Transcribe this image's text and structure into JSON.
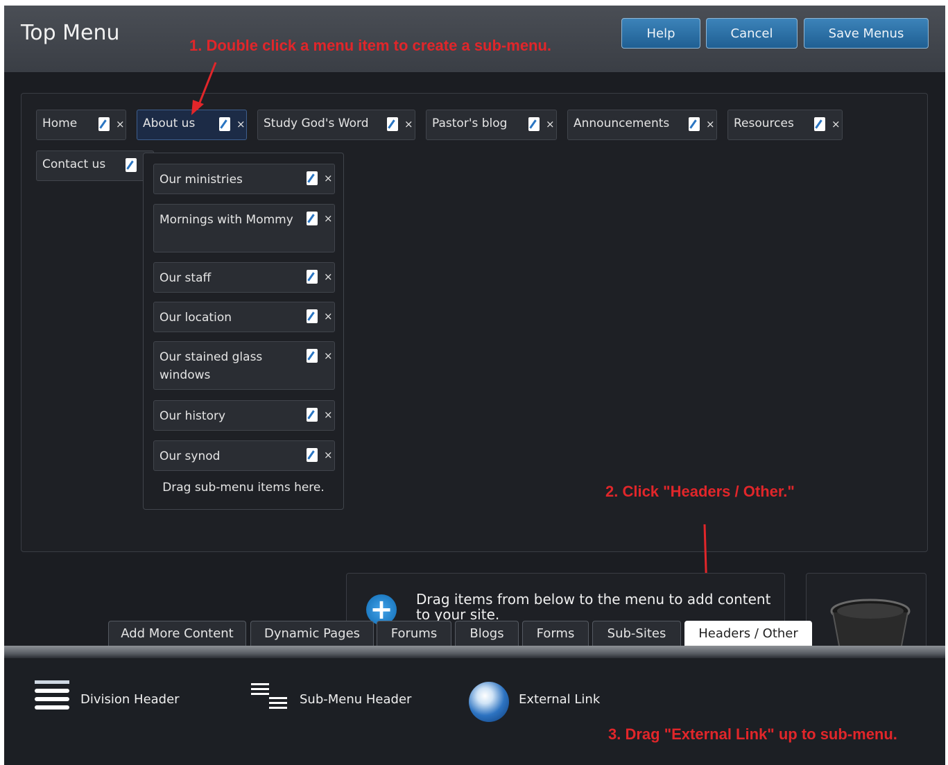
{
  "header": {
    "title": "Top Menu",
    "buttons": {
      "help": "Help",
      "cancel": "Cancel",
      "save": "Save Menus"
    }
  },
  "annotations": {
    "step1": "1. Double click a menu item to create a sub-menu.",
    "step2": "2. Click \"Headers / Other.\"",
    "step3": "3. Drag \"External Link\" up to sub-menu."
  },
  "menu": {
    "items": [
      "Home",
      "About us",
      "Study God's Word",
      "Pastor's blog",
      "Announcements",
      "Resources",
      "Contact us"
    ],
    "selected": "About us",
    "delete_glyph": "×"
  },
  "submenu": {
    "items": [
      "Our ministries",
      "Mornings with Mommy",
      "Our staff",
      "Our location",
      "Our stained glass windows",
      "Our history",
      "Our synod"
    ],
    "hint": "Drag sub-menu items here."
  },
  "add_content": {
    "text": "Drag items from below to the menu to add content to your site.",
    "plus_glyph": "+"
  },
  "tabs": {
    "items": [
      "Add More Content",
      "Dynamic Pages",
      "Forums",
      "Blogs",
      "Forms",
      "Sub-Sites",
      "Headers / Other"
    ],
    "active": "Headers / Other"
  },
  "palette": {
    "items": [
      "Division Header",
      "Sub-Menu Header",
      "External Link"
    ]
  },
  "colors": {
    "accent": "#1f5f93",
    "annotation": "#e1262a",
    "background": "#1b1d22"
  }
}
